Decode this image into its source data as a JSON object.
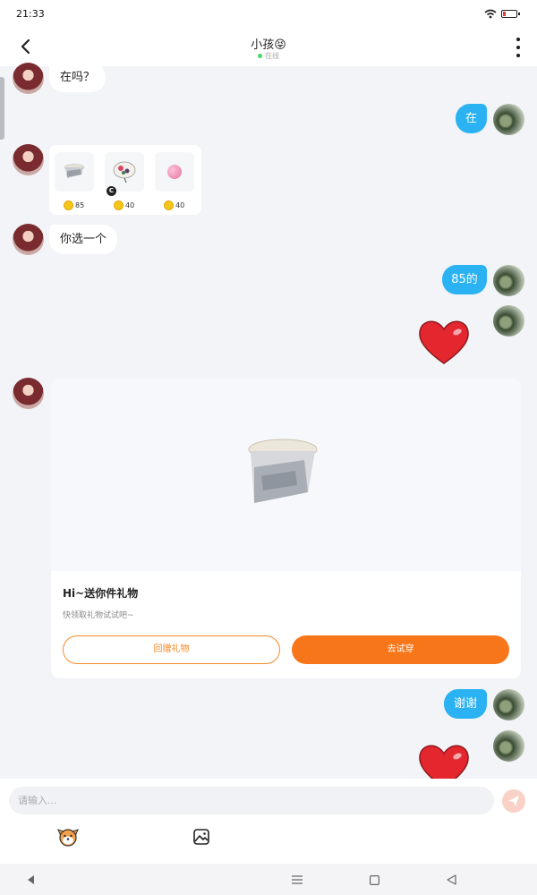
{
  "status_bar": {
    "time": "21:33"
  },
  "header": {
    "title": "小孩😝",
    "status": "在线"
  },
  "messages": {
    "m1": "在吗？",
    "m2": "在",
    "m3": "你选一个",
    "m4": "85的",
    "m5": "谢谢"
  },
  "gifts": [
    {
      "price": "85",
      "icon": "hat-icon"
    },
    {
      "price": "40",
      "icon": "fan-icon"
    },
    {
      "price": "40",
      "icon": "pink-ball-icon"
    }
  ],
  "gift_badge": "C",
  "card": {
    "title": "Hi~送你件礼物",
    "subtitle": "快领取礼物试试吧~",
    "return_button": "回赠礼物",
    "try_button": "去试穿"
  },
  "input": {
    "placeholder": "请输入..."
  },
  "colors": {
    "bubble_right": "#2ab2f2",
    "accent": "#f8761a",
    "heart": "#e4262f"
  }
}
